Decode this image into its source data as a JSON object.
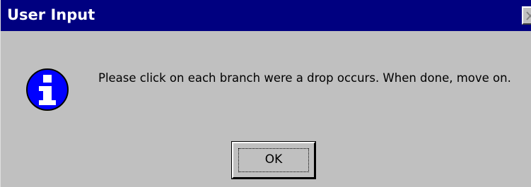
{
  "window": {
    "title": "User Input",
    "close_icon": "close-icon"
  },
  "dialog": {
    "icon": "info-icon",
    "message": "Please click on each branch were a drop occurs.  When done, move on.",
    "ok_label": "OK"
  },
  "colors": {
    "titlebar": "#000080",
    "face": "#c0c0c0",
    "icon_blue": "#0000ff"
  }
}
